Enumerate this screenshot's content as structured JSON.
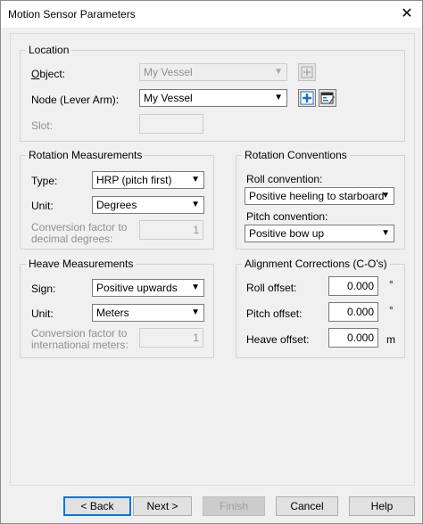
{
  "window": {
    "title": "Motion Sensor Parameters",
    "close_glyph": "✕"
  },
  "location": {
    "title": "Location",
    "object_label": "Object:",
    "object_value": "My Vessel",
    "node_label": "Node (Lever Arm):",
    "node_value": "My Vessel",
    "slot_label": "Slot:",
    "slot_value": ""
  },
  "rotation_measurements": {
    "title": "Rotation Measurements",
    "type_label": "Type:",
    "type_value": "HRP (pitch first)",
    "unit_label": "Unit:",
    "unit_value": "Degrees",
    "conv_label_1": "Conversion factor to",
    "conv_label_2": "decimal degrees:",
    "conv_value": "1"
  },
  "rotation_conventions": {
    "title": "Rotation Conventions",
    "roll_label": "Roll convention:",
    "roll_value": "Positive heeling to starboard",
    "pitch_label": "Pitch convention:",
    "pitch_value": "Positive bow up"
  },
  "heave_measurements": {
    "title": "Heave Measurements",
    "sign_label": "Sign:",
    "sign_value": "Positive upwards",
    "unit_label": "Unit:",
    "unit_value": "Meters",
    "conv_label_1": "Conversion factor to",
    "conv_label_2": "international meters:",
    "conv_value": "1"
  },
  "alignment_corrections": {
    "title": "Alignment Corrections (C-O's)",
    "roll_label": "Roll offset:",
    "roll_value": "0.000",
    "roll_unit": "°",
    "pitch_label": "Pitch offset:",
    "pitch_value": "0.000",
    "pitch_unit": "°",
    "heave_label": "Heave offset:",
    "heave_value": "0.000",
    "heave_unit": "m"
  },
  "buttons": {
    "back": "< Back",
    "next": "Next >",
    "finish": "Finish",
    "cancel": "Cancel",
    "help": "Help"
  },
  "colors": {
    "accent": "#0078d7",
    "icon_blue": "#1f6fc5"
  }
}
